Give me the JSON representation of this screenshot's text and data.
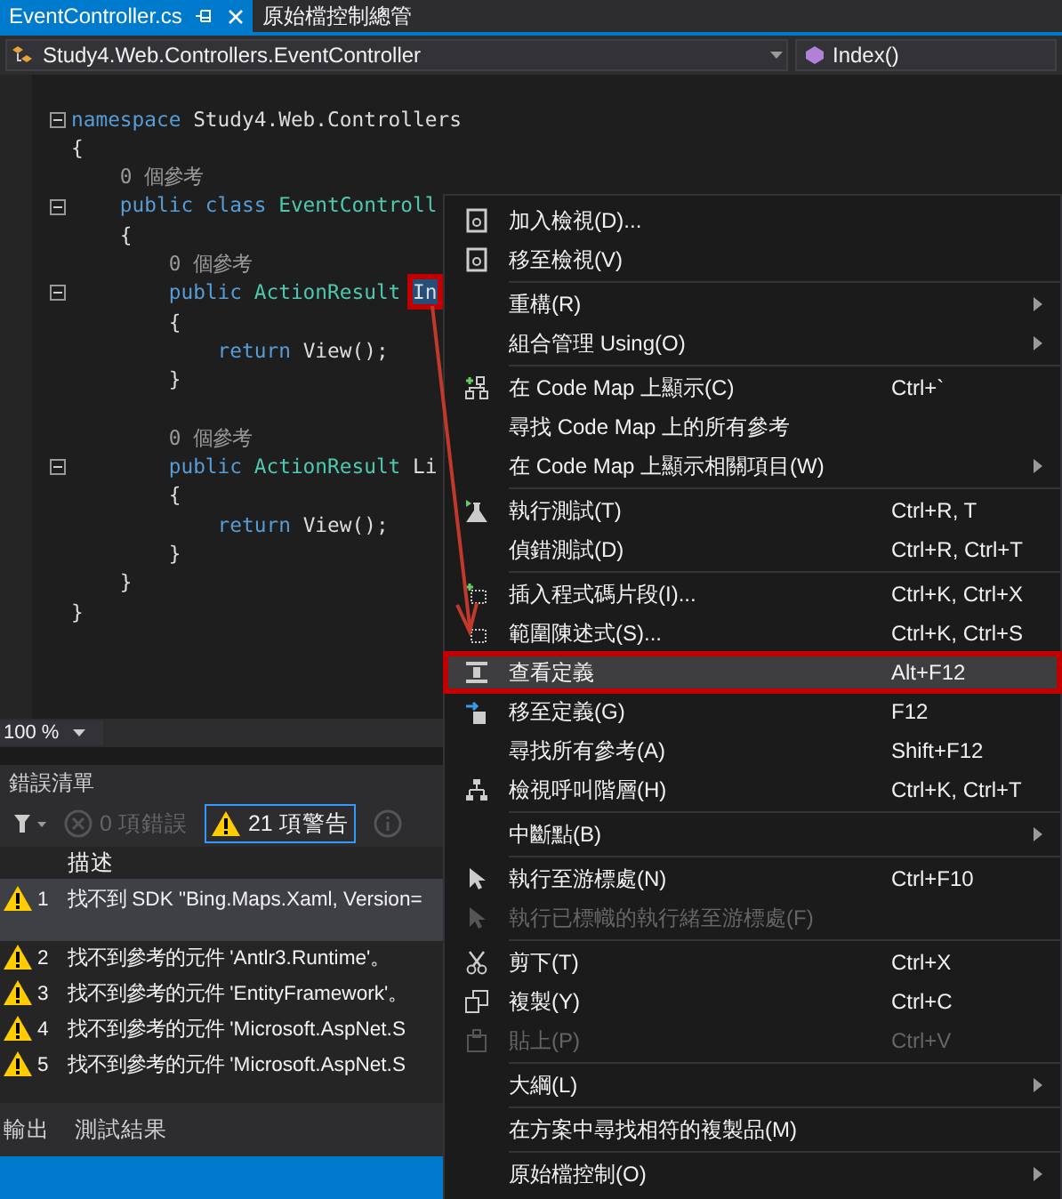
{
  "tabs": [
    {
      "label": "EventController.cs",
      "selected": true,
      "pinned": true
    },
    {
      "label": "原始檔控制總管",
      "selected": false,
      "pinned": false
    }
  ],
  "nav": {
    "type_path": "Study4.Web.Controllers.EventController",
    "member": "Index()"
  },
  "code": [
    {
      "fold": true,
      "tokens": [
        {
          "text": "namespace ",
          "kind": "keyword"
        },
        {
          "text": "Study4.Web.Controllers",
          "kind": "plain"
        }
      ]
    },
    {
      "fold": false,
      "tokens": [
        {
          "text": "{",
          "kind": "plain"
        }
      ]
    },
    {
      "fold": false,
      "tokens": [
        {
          "text": "    0 個參考",
          "kind": "lens"
        }
      ]
    },
    {
      "fold": true,
      "tokens": [
        {
          "text": "    public class ",
          "kind": "keyword"
        },
        {
          "text": "EventControll",
          "kind": "type"
        }
      ]
    },
    {
      "fold": false,
      "tokens": [
        {
          "text": "    {",
          "kind": "plain"
        }
      ]
    },
    {
      "fold": false,
      "tokens": [
        {
          "text": "        0 個參考",
          "kind": "lens"
        }
      ]
    },
    {
      "fold": true,
      "tokens": [
        {
          "text": "        public ",
          "kind": "keyword"
        },
        {
          "text": "ActionResult ",
          "kind": "type"
        },
        {
          "text": "In",
          "kind": "plain",
          "highlighted": true
        }
      ]
    },
    {
      "fold": false,
      "tokens": [
        {
          "text": "        {",
          "kind": "plain"
        }
      ]
    },
    {
      "fold": false,
      "tokens": [
        {
          "text": "            return ",
          "kind": "keyword"
        },
        {
          "text": "View();",
          "kind": "plain"
        }
      ]
    },
    {
      "fold": false,
      "tokens": [
        {
          "text": "        }",
          "kind": "plain"
        }
      ]
    },
    {
      "fold": false
    },
    {
      "fold": false,
      "tokens": [
        {
          "text": "        0 個參考",
          "kind": "lens"
        }
      ]
    },
    {
      "fold": true,
      "tokens": [
        {
          "text": "        public ",
          "kind": "keyword"
        },
        {
          "text": "ActionResult ",
          "kind": "type"
        },
        {
          "text": "Li",
          "kind": "plain",
          "highlighted": false
        }
      ]
    },
    {
      "fold": false,
      "tokens": [
        {
          "text": "        {",
          "kind": "plain"
        }
      ]
    },
    {
      "fold": false,
      "tokens": [
        {
          "text": "            return ",
          "kind": "keyword"
        },
        {
          "text": "View();",
          "kind": "plain"
        }
      ]
    },
    {
      "fold": false,
      "tokens": [
        {
          "text": "        }",
          "kind": "plain"
        }
      ]
    },
    {
      "fold": false,
      "tokens": [
        {
          "text": "    }",
          "kind": "plain"
        }
      ]
    },
    {
      "fold": false,
      "tokens": [
        {
          "text": "}",
          "kind": "plain"
        }
      ]
    }
  ],
  "zoom": "100 %",
  "error_list": {
    "title": "錯誤清單",
    "filters": [
      {
        "kind": "error",
        "label": "0 項錯誤",
        "selected": false
      },
      {
        "kind": "warning",
        "label": "21 項警告",
        "selected": true
      },
      {
        "kind": "info",
        "selected": false
      }
    ],
    "column": "描述",
    "rows": [
      {
        "number": "1",
        "text": "找不到 SDK \"Bing.Maps.Xaml, Version=",
        "selected": true
      },
      {
        "number": "2",
        "text": "找不到參考的元件 'Antlr3.Runtime'。",
        "selected": false
      },
      {
        "number": "3",
        "text": "找不到參考的元件 'EntityFramework'。",
        "selected": false
      },
      {
        "number": "4",
        "text": "找不到參考的元件 'Microsoft.AspNet.S",
        "selected": false
      },
      {
        "number": "5",
        "text": "找不到參考的元件 'Microsoft.AspNet.S",
        "selected": false
      }
    ]
  },
  "bottom_tabs": [
    "輸出",
    "測試結果"
  ],
  "context_menu": [
    [
      {
        "label": "加入檢視(D)...",
        "submenu": false,
        "disabled": false,
        "selected": false
      },
      {
        "label": "移至檢視(V)",
        "submenu": false,
        "disabled": false,
        "selected": false
      }
    ],
    [
      {
        "label": "重構(R)",
        "submenu": true,
        "disabled": false,
        "selected": false
      },
      {
        "label": "組合管理 Using(O)",
        "submenu": true,
        "disabled": false,
        "selected": false
      }
    ],
    [
      {
        "label": "在 Code Map 上顯示(C)",
        "shortcut": "Ctrl+`",
        "submenu": false,
        "disabled": false,
        "selected": false
      },
      {
        "label": "尋找 Code Map 上的所有參考",
        "submenu": false,
        "disabled": false,
        "selected": false
      },
      {
        "label": "在 Code Map 上顯示相關項目(W)",
        "submenu": true,
        "disabled": false,
        "selected": false
      }
    ],
    [
      {
        "label": "執行測試(T)",
        "shortcut": "Ctrl+R, T",
        "submenu": false,
        "disabled": false,
        "selected": false
      },
      {
        "label": "偵錯測試(D)",
        "shortcut": "Ctrl+R, Ctrl+T",
        "submenu": false,
        "disabled": false,
        "selected": false
      }
    ],
    [
      {
        "label": "插入程式碼片段(I)...",
        "shortcut": "Ctrl+K, Ctrl+X",
        "submenu": false,
        "disabled": false,
        "selected": false
      },
      {
        "label": "範圍陳述式(S)...",
        "shortcut": "Ctrl+K, Ctrl+S",
        "submenu": false,
        "disabled": false,
        "selected": false
      },
      {
        "label": "查看定義",
        "shortcut": "Alt+F12",
        "submenu": false,
        "disabled": false,
        "selected": true
      },
      {
        "label": "移至定義(G)",
        "shortcut": "F12",
        "submenu": false,
        "disabled": false,
        "selected": false
      },
      {
        "label": "尋找所有參考(A)",
        "shortcut": "Shift+F12",
        "submenu": false,
        "disabled": false,
        "selected": false
      },
      {
        "label": "檢視呼叫階層(H)",
        "shortcut": "Ctrl+K, Ctrl+T",
        "submenu": false,
        "disabled": false,
        "selected": false
      }
    ],
    [
      {
        "label": "中斷點(B)",
        "submenu": true,
        "disabled": false,
        "selected": false
      }
    ],
    [
      {
        "label": "執行至游標處(N)",
        "shortcut": "Ctrl+F10",
        "submenu": false,
        "disabled": false,
        "selected": false
      },
      {
        "label": "執行已標幟的執行緒至游標處(F)",
        "submenu": false,
        "disabled": true,
        "selected": false
      }
    ],
    [
      {
        "label": "剪下(T)",
        "shortcut": "Ctrl+X",
        "submenu": false,
        "disabled": false,
        "selected": false
      },
      {
        "label": "複製(Y)",
        "shortcut": "Ctrl+C",
        "submenu": false,
        "disabled": false,
        "selected": false
      },
      {
        "label": "貼上(P)",
        "shortcut": "Ctrl+V",
        "submenu": false,
        "disabled": true,
        "selected": false
      }
    ],
    [
      {
        "label": "大綱(L)",
        "submenu": true,
        "disabled": false,
        "selected": false
      }
    ],
    [
      {
        "label": "在方案中尋找相符的複製品(M)",
        "submenu": false,
        "disabled": false,
        "selected": false
      }
    ],
    [
      {
        "label": "原始檔控制(O)",
        "submenu": true,
        "disabled": false,
        "selected": false
      }
    ]
  ]
}
